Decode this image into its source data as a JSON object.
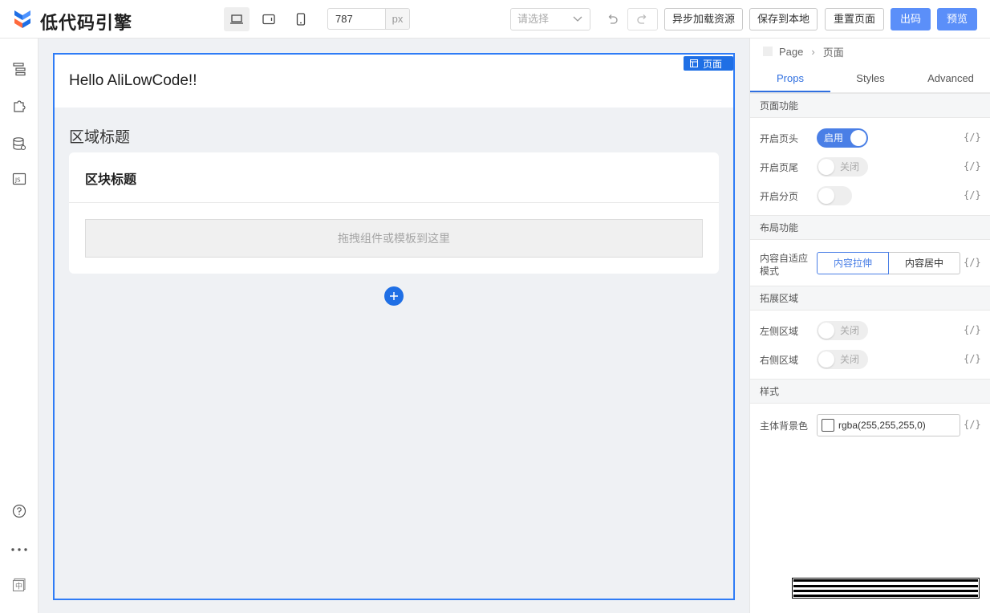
{
  "app": {
    "title": "低代码引擎"
  },
  "toolbar": {
    "width_value": "787",
    "width_unit": "px",
    "select_placeholder": "请选择",
    "async_load_label": "异步加载资源",
    "save_local_label": "保存到本地",
    "reset_page_label": "重置页面",
    "export_label": "出码",
    "preview_label": "预览",
    "colors": {
      "primary": "#5b8ff9",
      "selection": "#2f7cf6"
    }
  },
  "canvas": {
    "header_title": "Hello AliLowCode!!",
    "page_badge": "页面",
    "section_title": "区域标题",
    "block_title": "区块标题",
    "dropzone_text": "拖拽组件或模板到这里"
  },
  "panel": {
    "breadcrumb": {
      "root": "Page",
      "current": "页面"
    },
    "tabs": [
      "Props",
      "Styles",
      "Advanced"
    ],
    "sections": {
      "page_features": "页面功能",
      "layout_features": "布局功能",
      "extension_area": "拓展区域",
      "style": "样式"
    },
    "rows": {
      "enable_header": {
        "label": "开启页头",
        "switch_label": "启用",
        "on": true
      },
      "enable_footer": {
        "label": "开启页尾",
        "switch_label": "关闭",
        "on": false
      },
      "enable_pagination": {
        "label": "开启分页",
        "on": false
      },
      "adaptive_mode": {
        "label_line1": "内容自适应",
        "label_line2": "模式",
        "options": [
          "内容拉伸",
          "内容居中"
        ],
        "selected": "内容拉伸"
      },
      "left_area": {
        "label": "左侧区域",
        "switch_label": "关闭",
        "on": false
      },
      "right_area": {
        "label": "右侧区域",
        "switch_label": "关闭",
        "on": false
      },
      "bg_color": {
        "label": "主体背景色",
        "value": "rgba(255,255,255,0)"
      }
    },
    "expression_toggle": "{/}"
  }
}
